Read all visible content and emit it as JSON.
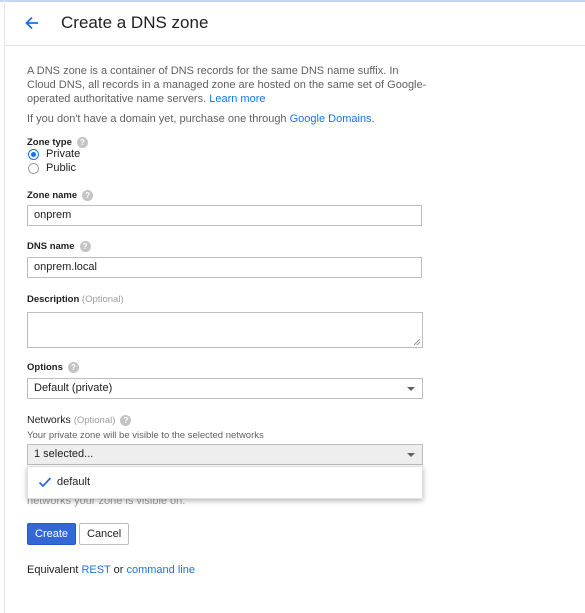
{
  "header": {
    "title": "Create a DNS zone",
    "back_icon": "arrow-left-icon"
  },
  "intro": {
    "text": "A DNS zone is a container of DNS records for the same DNS name suffix. In Cloud DNS, all records in a managed zone are hosted on the same set of Google-operated authoritative name servers.",
    "learn_more": "Learn more"
  },
  "domain_hint": {
    "text": "If you don't have a domain yet, purchase one through",
    "link": "Google Domains",
    "end": "."
  },
  "zone_type": {
    "label": "Zone type",
    "options": [
      "Private",
      "Public"
    ],
    "selected": "Private"
  },
  "zone_name": {
    "label": "Zone name",
    "value": "onprem"
  },
  "dns_name": {
    "label": "DNS name",
    "value": "onprem.local"
  },
  "description": {
    "label": "Description",
    "optional": "(Optional)",
    "value": ""
  },
  "options": {
    "label": "Options",
    "value": "Default (private)"
  },
  "networks": {
    "label": "Networks",
    "optional": "(Optional)",
    "hint": "Your private zone will be visible to the selected networks",
    "value": "1 selected...",
    "items": [
      {
        "label": "default",
        "checked": true
      }
    ],
    "obscured_text": "networks your zone is visible on."
  },
  "buttons": {
    "create": "Create",
    "cancel": "Cancel"
  },
  "footer": {
    "prefix": "Equivalent",
    "rest": "REST",
    "or": "or",
    "command_line": "command line"
  },
  "colors": {
    "accent": "#1a73e8",
    "primary_button": "#3367d6"
  }
}
